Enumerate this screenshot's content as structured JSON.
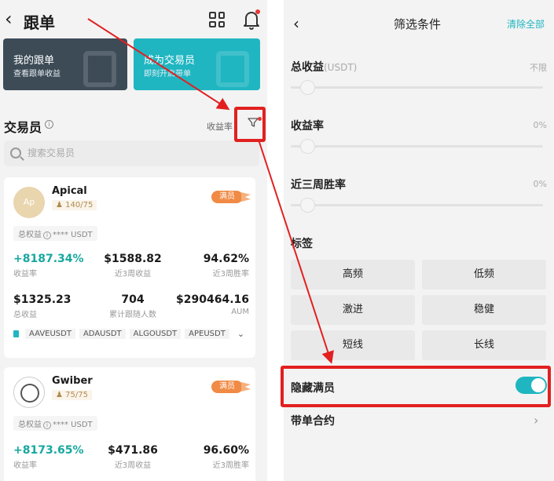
{
  "left": {
    "back_icon": "chevron-left-icon",
    "title": "跟单",
    "grid_icon": "grid-icon",
    "bell_icon": "bell-icon",
    "promo_cards": [
      {
        "title": "我的跟单",
        "subtitle": "查看跟单收益"
      },
      {
        "title": "成为交易员",
        "subtitle": "即刻开启带单"
      }
    ],
    "section_title": "交易员",
    "info_glyph": "i",
    "sort_label": "收益率",
    "filter_icon": "filter-icon",
    "search_placeholder": "搜索交易员",
    "traders": [
      {
        "name": "Apical",
        "avatar_text": "Ap",
        "followers": "140/75",
        "badge": "满员",
        "equity_label": "总权益",
        "equity_value": "**** USDT",
        "stats_row1": [
          {
            "value": "+8187.34%",
            "label": "收益率"
          },
          {
            "value": "$1588.82",
            "label": "近3周收益"
          },
          {
            "value": "94.62%",
            "label": "近3周胜率"
          }
        ],
        "stats_row2": [
          {
            "value": "$1325.23",
            "label": "总收益"
          },
          {
            "value": "704",
            "label": "累计跟随人数"
          },
          {
            "value": "$290464.16",
            "label": "AUM"
          }
        ],
        "tags": [
          "AAVEUSDT",
          "ADAUSDT",
          "ALGOUSDT",
          "APEUSDT"
        ]
      },
      {
        "name": "Gwiber",
        "followers": "75/75",
        "badge": "满员",
        "equity_label": "总权益",
        "equity_value": "**** USDT",
        "stats_row1": [
          {
            "value": "+8173.65%",
            "label": "收益率"
          },
          {
            "value": "$471.86",
            "label": "近3周收益"
          },
          {
            "value": "96.60%",
            "label": "近3周胜率"
          }
        ]
      }
    ]
  },
  "right": {
    "title": "筛选条件",
    "clear_all": "清除全部",
    "filters": [
      {
        "label": "总收益",
        "sub": "(USDT)",
        "value": "不限"
      },
      {
        "label": "收益率",
        "value": "0%"
      },
      {
        "label": "近三周胜率",
        "value": "0%"
      }
    ],
    "tags_title": "标签",
    "tag_options": [
      "高频",
      "低频",
      "激进",
      "稳健",
      "短线",
      "长线"
    ],
    "hide_full_label": "隐藏满员",
    "hide_full_enabled": true,
    "contract_label": "带单合约"
  },
  "colors": {
    "accent": "#1fb6c1",
    "gain": "#17a89f",
    "highlight": "#e22020",
    "badge": "#f08a44"
  }
}
